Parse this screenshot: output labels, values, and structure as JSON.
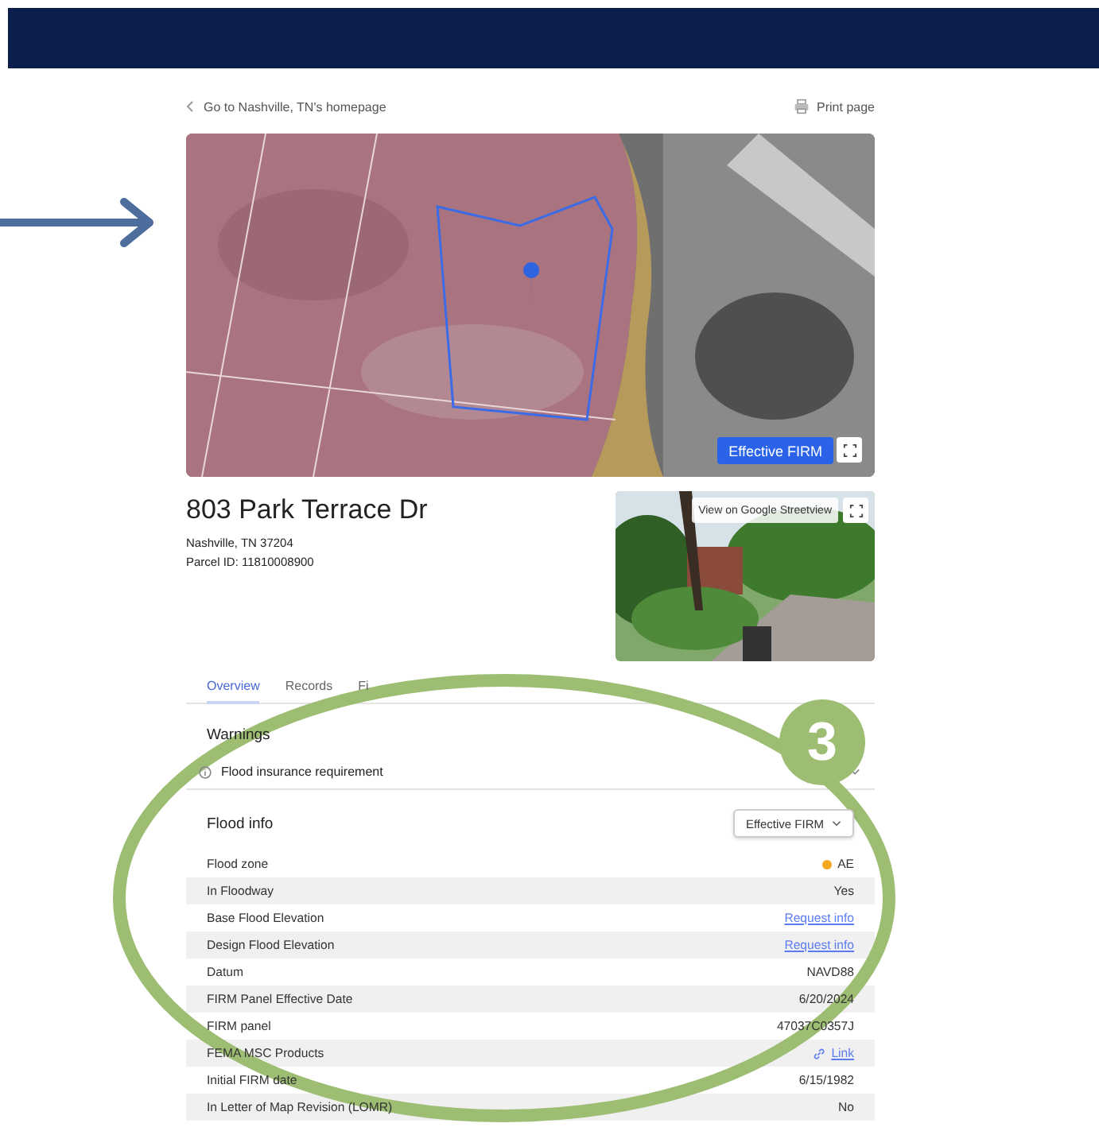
{
  "nav": {
    "back_link": "Go to Nashville, TN's homepage",
    "print": "Print page"
  },
  "map": {
    "kind": "picture",
    "layer_button": "Effective FIRM"
  },
  "property": {
    "address": "803 Park Terrace Dr",
    "city": "Nashville, TN 37204",
    "parcel": "Parcel ID: 11810008900"
  },
  "streetview": {
    "kind": "picture",
    "button": "View on Google Streetview"
  },
  "tabs": [
    {
      "label": "Overview",
      "selected": true
    },
    {
      "label": "Records",
      "selected": false
    },
    {
      "label": "Fi",
      "selected": false
    }
  ],
  "warnings": {
    "title": "Warnings",
    "items": [
      {
        "label": "Flood insurance requirement",
        "expanded": false
      }
    ]
  },
  "flood_info": {
    "title": "Flood info",
    "dropdown": "Effective FIRM",
    "rows": [
      {
        "label": "Flood zone",
        "value": "AE",
        "kind": "status"
      },
      {
        "label": "In Floodway",
        "value": "Yes",
        "kind": "text"
      },
      {
        "label": "Base Flood Elevation",
        "value": "Request info",
        "kind": "link"
      },
      {
        "label": "Design Flood Elevation",
        "value": "Request info",
        "kind": "link"
      },
      {
        "label": "Datum",
        "value": "NAVD88",
        "kind": "text"
      },
      {
        "label": "FIRM Panel Effective Date",
        "value": "6/20/2024",
        "kind": "text"
      },
      {
        "label": "FIRM panel",
        "value": "47037C0357J",
        "kind": "text"
      },
      {
        "label": "FEMA MSC Products",
        "value": "Link",
        "kind": "external"
      },
      {
        "label": "Initial FIRM date",
        "value": "6/15/1982",
        "kind": "text"
      },
      {
        "label": "In Letter of Map Revision (LOMR)",
        "value": "No",
        "kind": "text"
      }
    ]
  },
  "callout": {
    "number": "3"
  }
}
